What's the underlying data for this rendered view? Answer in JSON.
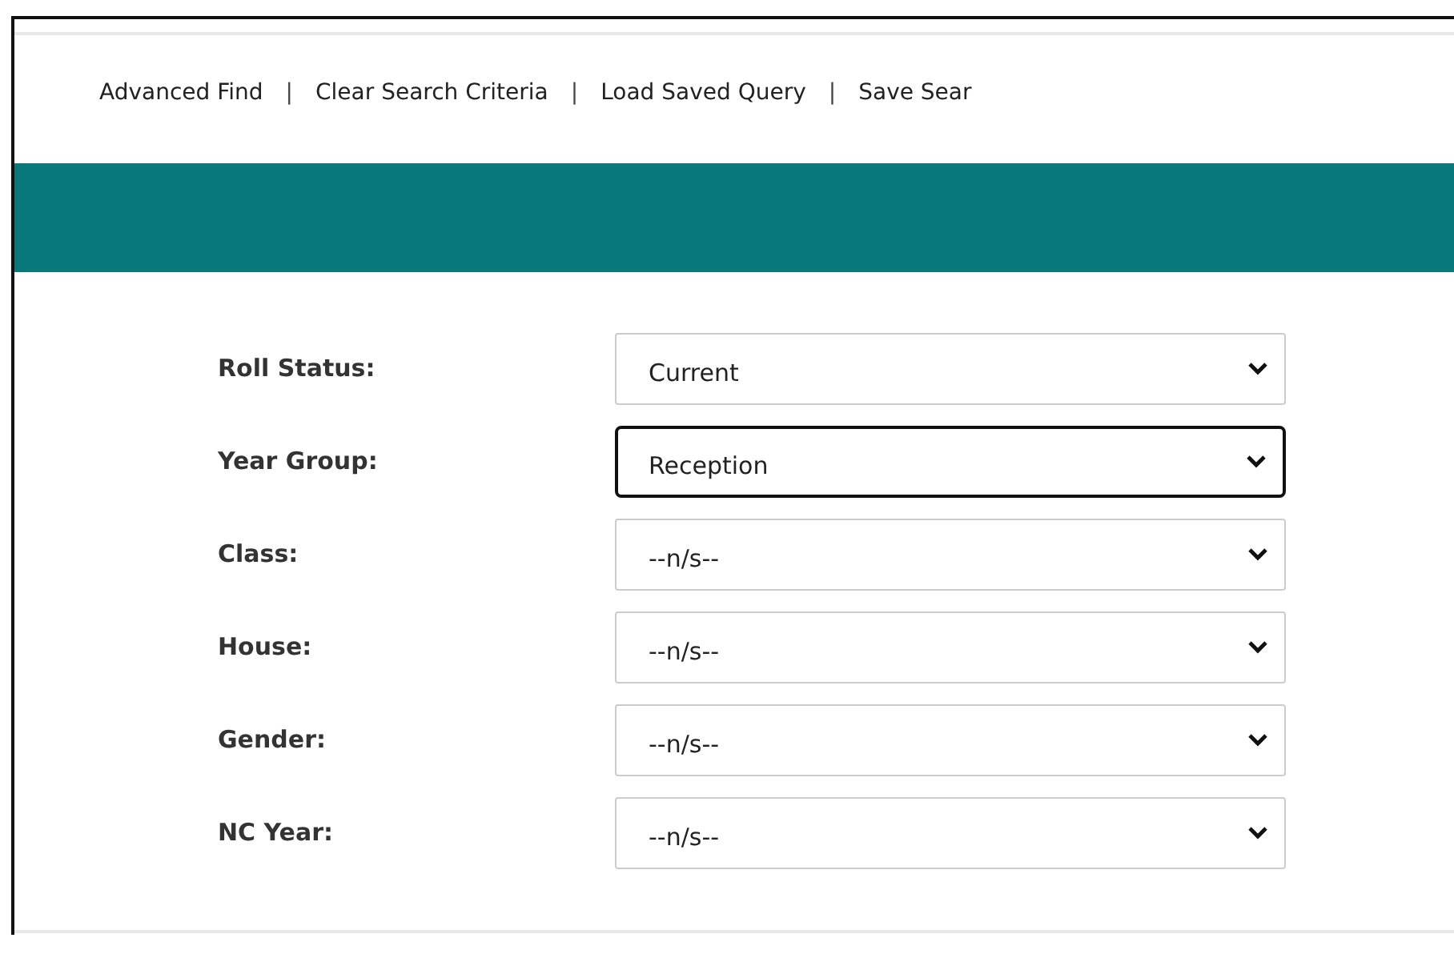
{
  "toolbar": [
    {
      "kind": "link",
      "text": "Advanced Find"
    },
    {
      "kind": "separator",
      "text": "|"
    },
    {
      "kind": "link",
      "text": "Clear Search Criteria"
    },
    {
      "kind": "separator",
      "text": "|"
    },
    {
      "kind": "link",
      "text": "Load Saved Query"
    },
    {
      "kind": "separator",
      "text": "|"
    },
    {
      "kind": "link",
      "text": "Save Sear"
    }
  ],
  "fields": [
    {
      "label": "Roll Status:",
      "value": "Current",
      "focused": false
    },
    {
      "label": "Year Group:",
      "value": "Reception",
      "focused": true
    },
    {
      "label": "Class:",
      "value": "--n/s--",
      "focused": false
    },
    {
      "label": "House:",
      "value": "--n/s--",
      "focused": false
    },
    {
      "label": "Gender:",
      "value": "--n/s--",
      "focused": false
    },
    {
      "label": "NC Year:",
      "value": "--n/s--",
      "focused": false
    }
  ]
}
